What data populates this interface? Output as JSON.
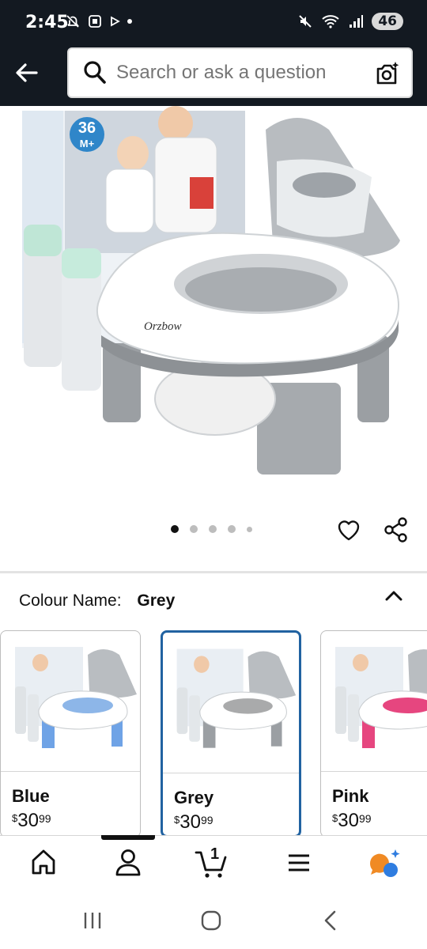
{
  "status_bar": {
    "time": "2:45",
    "battery": "46"
  },
  "search": {
    "placeholder": "Search or ask a question"
  },
  "gallery": {
    "image_count": 5,
    "active_index": 0,
    "brand_mark": "Orzbow",
    "age_badge_top": "36",
    "age_badge_bottom": "M+"
  },
  "variation": {
    "label": "Colour Name:",
    "selected": "Grey",
    "options": [
      {
        "name": "Blue",
        "currency": "$",
        "whole": "30",
        "cents": "99",
        "color": "#8db6e8"
      },
      {
        "name": "Grey",
        "currency": "$",
        "whole": "30",
        "cents": "99",
        "color": "#a9aaab"
      },
      {
        "name": "Pink",
        "currency": "$",
        "whole": "30",
        "cents": "99",
        "color": "#e6467f"
      }
    ]
  },
  "bottom_nav": {
    "cart_count": "1",
    "items": [
      "home-icon",
      "account-icon",
      "cart-icon",
      "menu-icon",
      "assistant-icon"
    ]
  },
  "colors": {
    "header_bg": "#131921",
    "selected_border": "#2162a1",
    "assistant_orange": "#f08a24",
    "assistant_blue": "#2f7de0"
  }
}
